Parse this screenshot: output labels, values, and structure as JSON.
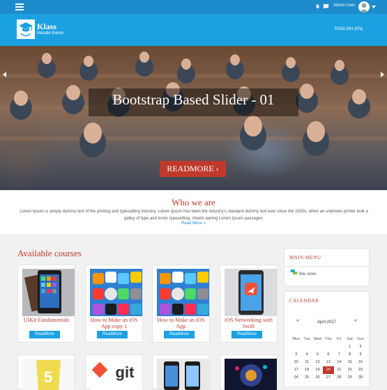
{
  "topbar": {
    "user_name": "Admin User"
  },
  "brand": {
    "name": "Klass",
    "subtitle": "Moodle theme"
  },
  "language": {
    "label": "ENGLISH (EN)"
  },
  "slider": {
    "caption": "Bootstrap Based Slider - 01",
    "readmore_label": "READMORE"
  },
  "who_we_are": {
    "title": "Who we are",
    "text": "Lorem Ipsum is simply dummy text of the printing and typesetting industry. Lorem Ipsum has been the industry's standard dummy text ever since the 1500s, when an unknown printer took a galley of type and tronic typesetting, sheets taining Lorem Ipsum passages.",
    "link": "Read More »"
  },
  "courses": {
    "title": "Available courses",
    "items": [
      {
        "name": "UIKit Fundamentals",
        "button": "ReadMore"
      },
      {
        "name": "How to Make an iOS App copy 1",
        "button": "ReadMore"
      },
      {
        "name": "How to Make an iOS App",
        "button": "ReadMore"
      },
      {
        "name": "iOS Networking with Swift",
        "button": "ReadMore"
      }
    ],
    "bottom_row_labels": [
      "git"
    ]
  },
  "main_menu": {
    "title": "MAIN MENU",
    "item": "Site news"
  },
  "calendar": {
    "title": "CALENDAR",
    "month": "April 2017",
    "prev": "«",
    "next": "»",
    "weekdays": [
      "Mon",
      "Tue",
      "Wed",
      "Thu",
      "Fri",
      "Sat",
      "Sun"
    ],
    "weeks": [
      [
        "",
        "",
        "",
        "",
        "",
        "1",
        "2"
      ],
      [
        "3",
        "4",
        "5",
        "6",
        "7",
        "8",
        "9"
      ],
      [
        "10",
        "11",
        "12",
        "13",
        "14",
        "15",
        "16"
      ],
      [
        "17",
        "18",
        "19",
        "20",
        "21",
        "22",
        "23"
      ],
      [
        "24",
        "25",
        "26",
        "27",
        "28",
        "29",
        "30"
      ]
    ],
    "today": "20"
  },
  "colors": {
    "topbar": "#1d8ccc",
    "header": "#1ba1e2",
    "accent_red": "#c0392b",
    "button_blue": "#1ba1e2"
  }
}
